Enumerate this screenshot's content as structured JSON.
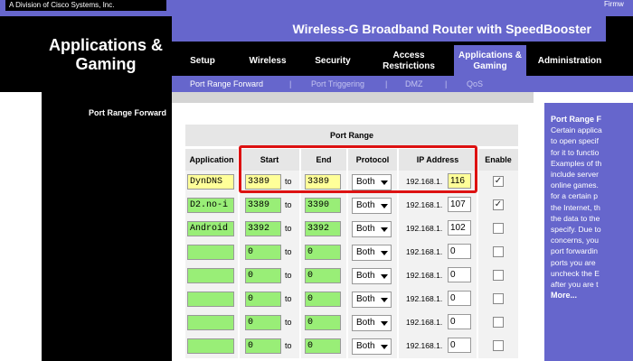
{
  "topbar": {
    "brand": "A Division of Cisco Systems, Inc.",
    "firmware": "Firmw"
  },
  "header": {
    "section_title": "Applications & Gaming",
    "product_name": "Wireless-G Broadband Router with SpeedBooster"
  },
  "nav": {
    "items": [
      {
        "label": "Setup"
      },
      {
        "label": "Wireless"
      },
      {
        "label": "Security"
      },
      {
        "label": "Access Restrictions"
      },
      {
        "label": "Applications & Gaming"
      },
      {
        "label": "Administration"
      }
    ],
    "active": "Applications & Gaming"
  },
  "subnav": {
    "items": [
      {
        "label": "Port Range Forward"
      },
      {
        "label": "Port Triggering"
      },
      {
        "label": "DMZ"
      },
      {
        "label": "QoS"
      }
    ],
    "separator": "|",
    "current": "Port Range Forward"
  },
  "left": {
    "section_label": "Port Range Forward"
  },
  "table": {
    "group_header": "Port Range",
    "columns": [
      "Application",
      "Start",
      "End",
      "Protocol",
      "IP Address",
      "Enable"
    ],
    "to_label": "to",
    "ip_prefix": "192.168.1.",
    "rows": [
      {
        "app": "DynDNS",
        "start": "3389",
        "end": "3389",
        "protocol": "Both",
        "ip": "116",
        "enabled": true
      },
      {
        "app": "D2.no-i",
        "start": "3389",
        "end": "3390",
        "protocol": "Both",
        "ip": "107",
        "enabled": true
      },
      {
        "app": "Android",
        "start": "3392",
        "end": "3392",
        "protocol": "Both",
        "ip": "102",
        "enabled": false
      },
      {
        "app": "",
        "start": "0",
        "end": "0",
        "protocol": "Both",
        "ip": "0",
        "enabled": false
      },
      {
        "app": "",
        "start": "0",
        "end": "0",
        "protocol": "Both",
        "ip": "0",
        "enabled": false
      },
      {
        "app": "",
        "start": "0",
        "end": "0",
        "protocol": "Both",
        "ip": "0",
        "enabled": false
      },
      {
        "app": "",
        "start": "0",
        "end": "0",
        "protocol": "Both",
        "ip": "0",
        "enabled": false
      },
      {
        "app": "",
        "start": "0",
        "end": "0",
        "protocol": "Both",
        "ip": "0",
        "enabled": false
      }
    ]
  },
  "help": {
    "title": "Port Range F",
    "lines": [
      "Certain applica",
      "to open specif",
      "for it to functio",
      "Examples of th",
      "include server",
      "online games.",
      "for a certain p",
      "the Internet, th",
      "the data to the",
      "specify. Due to",
      "concerns, you",
      "port forwardin",
      "ports you are",
      "uncheck the E",
      "after you are t"
    ],
    "more": "More..."
  },
  "colors": {
    "brand_purple": "#6666cc",
    "header_black": "#000000",
    "highlight_red": "#dd1111"
  }
}
